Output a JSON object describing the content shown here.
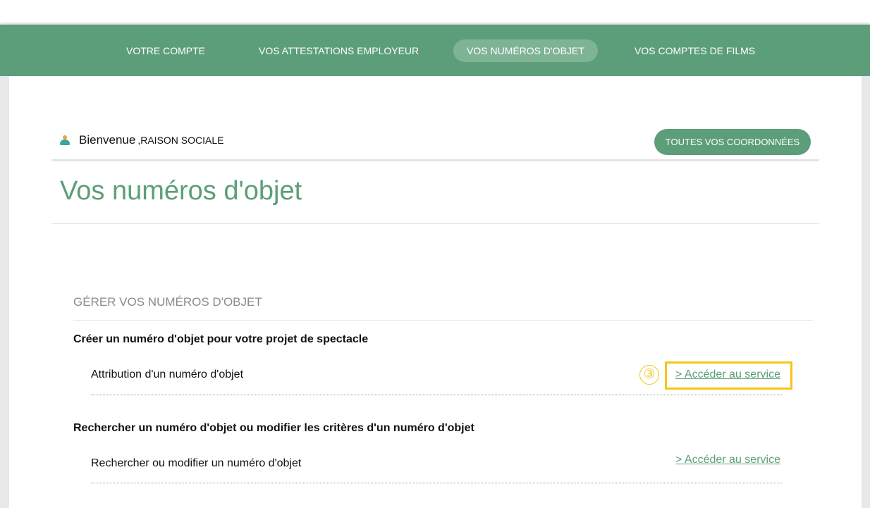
{
  "nav": {
    "items": [
      {
        "label": "VOTRE COMPTE",
        "active": false
      },
      {
        "label": "VOS ATTESTATIONS EMPLOYEUR",
        "active": false
      },
      {
        "label": "VOS NUMÉROS D'OBJET",
        "active": true
      },
      {
        "label": "VOS COMPTES DE FILMS",
        "active": false
      }
    ]
  },
  "welcome": {
    "greeting": "Bienvenue",
    "name": ",RAISON SOCIALE",
    "icon": "user-icon"
  },
  "header": {
    "coordinates_button": "TOUTES VOS COORDONNÉES"
  },
  "page": {
    "title": "Vos numéros d'objet"
  },
  "section": {
    "heading": "GÉRER VOS NUMÉROS D'OBJET",
    "groups": [
      {
        "title": "Créer un numéro d'objet pour votre projet de spectacle",
        "rows": [
          {
            "label": "Attribution d'un numéro d'objet",
            "link": "> Accéder au service"
          }
        ]
      },
      {
        "title": "Rechercher un numéro d'objet ou modifier les critères d'un numéro d'objet",
        "rows": [
          {
            "label": "Rechercher ou modifier un numéro d'objet",
            "link": "> Accéder au service"
          }
        ]
      }
    ]
  },
  "annotation": {
    "step": "③",
    "color": "#f5c518"
  },
  "colors": {
    "brand_green": "#5c9e79",
    "gutter_gray": "#e6e8ea"
  }
}
